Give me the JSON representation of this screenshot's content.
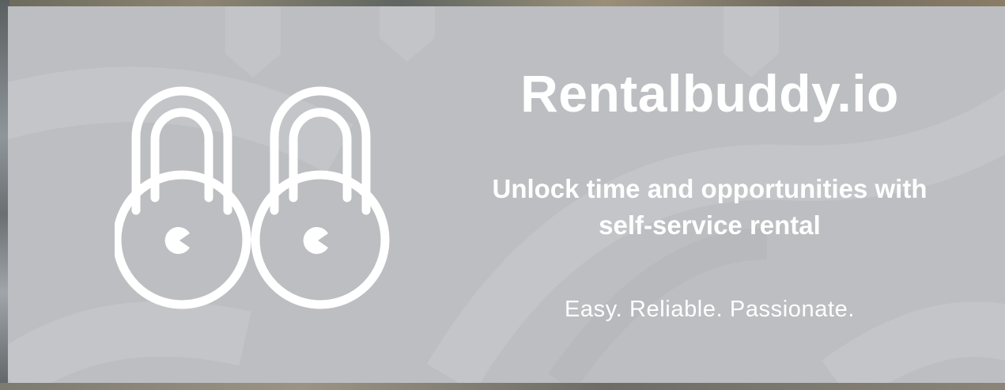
{
  "hero": {
    "title": "Rentalbuddy.io",
    "tagline_line1": "Unlock time and opportunities with",
    "tagline_line2": "self-service rental",
    "slogan": "Easy. Reliable. Passionate."
  },
  "colors": {
    "panel": "#bdbec2",
    "text": "#ffffff"
  },
  "icons": [
    "padlock-icon",
    "padlock-icon"
  ]
}
